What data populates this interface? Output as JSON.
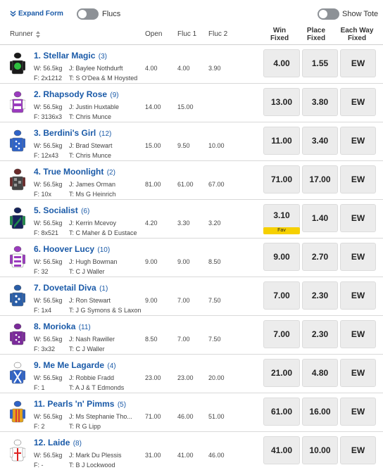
{
  "topbar": {
    "expand_label": "Expand Form",
    "flucs_label": "Flucs",
    "show_tote_label": "Show Tote"
  },
  "columns": {
    "runner": "Runner",
    "open": "Open",
    "fluc1": "Fluc 1",
    "fluc2": "Fluc 2",
    "win": "Win",
    "win2": "Fixed",
    "place": "Place",
    "place2": "Fixed",
    "ew": "Each Way",
    "ew2": "Fixed"
  },
  "colors": {
    "link_blue": "#1a5aa8",
    "fav_yellow": "#f6d000",
    "button_bg": "#ececec"
  },
  "runners": [
    {
      "num": "1.",
      "name": "Stellar Magic",
      "barrier": "(3)",
      "weight": "W: 56.5kg",
      "form": "F: 2x1212",
      "jockey": "J: Baylee Nothdurft",
      "trainer": "T: S O'Dea & M Hoysted",
      "open": "4.00",
      "fluc1": "4.00",
      "fluc2": "3.90",
      "win": "4.00",
      "place": "1.55",
      "ew": "EW",
      "fav": ""
    },
    {
      "num": "2.",
      "name": "Rhapsody Rose",
      "barrier": "(9)",
      "weight": "W: 56.5kg",
      "form": "F: 3136x3",
      "jockey": "J: Justin Huxtable",
      "trainer": "T: Chris Munce",
      "open": "14.00",
      "fluc1": "15.00",
      "fluc2": "",
      "win": "13.00",
      "place": "3.80",
      "ew": "EW",
      "fav": ""
    },
    {
      "num": "3.",
      "name": "Berdini's Girl",
      "barrier": "(12)",
      "weight": "W: 56.5kg",
      "form": "F: 12x43",
      "jockey": "J: Brad Stewart",
      "trainer": "T: Chris Munce",
      "open": "15.00",
      "fluc1": "9.50",
      "fluc2": "10.00",
      "win": "11.00",
      "place": "3.40",
      "ew": "EW",
      "fav": ""
    },
    {
      "num": "4.",
      "name": "True Moonlight",
      "barrier": "(2)",
      "weight": "W: 56.5kg",
      "form": "F: 10x",
      "jockey": "J: James Orman",
      "trainer": "T: Ms G Heinrich",
      "open": "81.00",
      "fluc1": "61.00",
      "fluc2": "67.00",
      "win": "71.00",
      "place": "17.00",
      "ew": "EW",
      "fav": ""
    },
    {
      "num": "5.",
      "name": "Socialist",
      "barrier": "(6)",
      "weight": "W: 56.5kg",
      "form": "F: 8x521",
      "jockey": "J: Kerrin Mcevoy",
      "trainer": "T: C Maher & D Eustace",
      "open": "4.20",
      "fluc1": "3.30",
      "fluc2": "3.20",
      "win": "3.10",
      "place": "1.40",
      "ew": "EW",
      "fav": "Fav"
    },
    {
      "num": "6.",
      "name": "Hoover Lucy",
      "barrier": "(10)",
      "weight": "W: 56.5kg",
      "form": "F: 32",
      "jockey": "J: Hugh Bowman",
      "trainer": "T: C J Waller",
      "open": "9.00",
      "fluc1": "9.00",
      "fluc2": "8.50",
      "win": "9.00",
      "place": "2.70",
      "ew": "EW",
      "fav": ""
    },
    {
      "num": "7.",
      "name": "Dovetail Diva",
      "barrier": "(1)",
      "weight": "W: 56.5kg",
      "form": "F: 1x4",
      "jockey": "J: Ron Stewart",
      "trainer": "T: J G Symons & S Laxon",
      "open": "9.00",
      "fluc1": "7.00",
      "fluc2": "7.50",
      "win": "7.00",
      "place": "2.30",
      "ew": "EW",
      "fav": ""
    },
    {
      "num": "8.",
      "name": "Morioka",
      "barrier": "(11)",
      "weight": "W: 56.5kg",
      "form": "F: 3x32",
      "jockey": "J: Nash Rawiller",
      "trainer": "T: C J Waller",
      "open": "8.50",
      "fluc1": "7.00",
      "fluc2": "7.50",
      "win": "7.00",
      "place": "2.30",
      "ew": "EW",
      "fav": ""
    },
    {
      "num": "9.",
      "name": "Me Me Lagarde",
      "barrier": "(4)",
      "weight": "W: 56.5kg",
      "form": "F: 1",
      "jockey": "J: Robbie Fradd",
      "trainer": "T: A J & T Edmonds",
      "open": "23.00",
      "fluc1": "23.00",
      "fluc2": "20.00",
      "win": "21.00",
      "place": "4.80",
      "ew": "EW",
      "fav": ""
    },
    {
      "num": "11.",
      "name": "Pearls 'n' Pimms",
      "barrier": "(5)",
      "weight": "W: 56.5kg",
      "form": "F: 2",
      "jockey": "J: Ms Stephanie Tho...",
      "trainer": "T: R G Lipp",
      "open": "71.00",
      "fluc1": "46.00",
      "fluc2": "51.00",
      "win": "61.00",
      "place": "16.00",
      "ew": "EW",
      "fav": ""
    },
    {
      "num": "12.",
      "name": "Laide",
      "barrier": "(8)",
      "weight": "W: 56.5kg",
      "form": "F: -",
      "jockey": "J: Mark Du Plessis",
      "trainer": "T: B J Lockwood",
      "open": "31.00",
      "fluc1": "41.00",
      "fluc2": "46.00",
      "win": "41.00",
      "place": "10.00",
      "ew": "EW",
      "fav": ""
    }
  ]
}
